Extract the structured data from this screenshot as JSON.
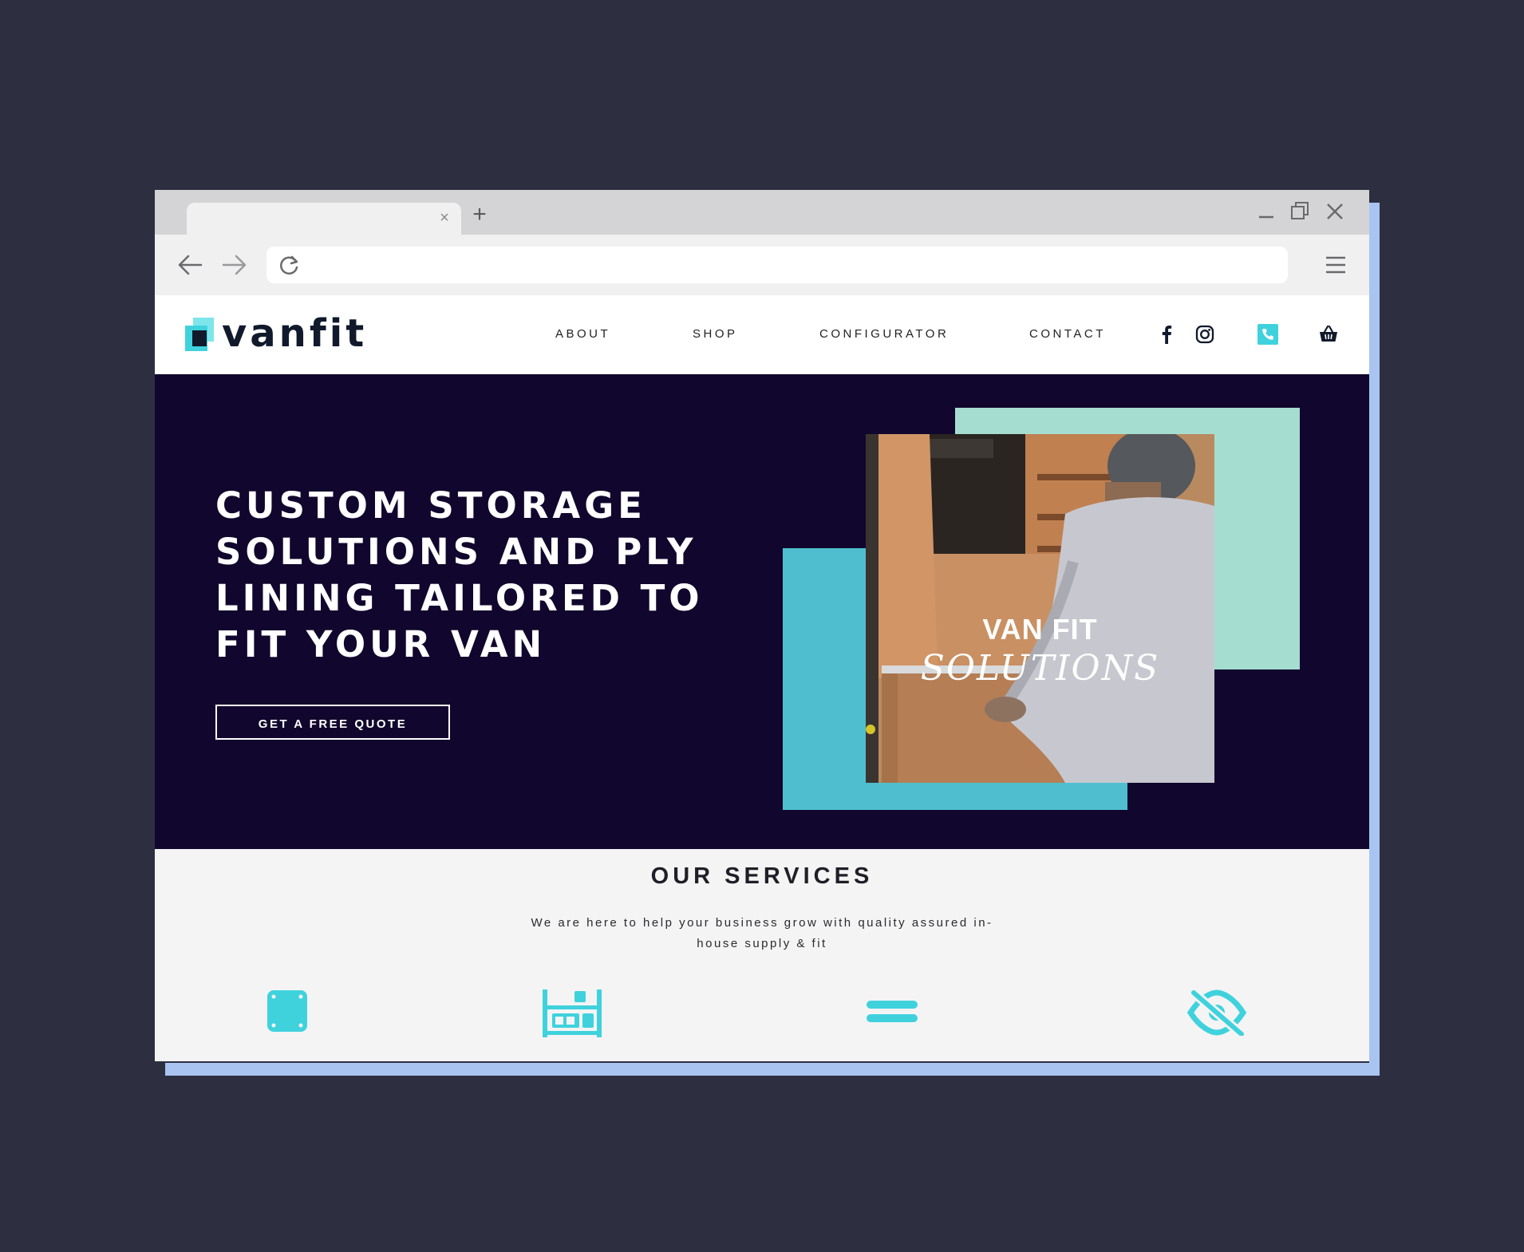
{
  "browser": {
    "tab_close": "×",
    "new_tab": "+",
    "url": ""
  },
  "header": {
    "logo_text": "vanfit",
    "nav": {
      "about": "ABOUT",
      "shop": "SHOP",
      "configurator": "CONFIGURATOR",
      "contact": "CONTACT"
    },
    "icons": [
      "facebook-icon",
      "instagram-icon",
      "phone-icon",
      "basket-icon"
    ]
  },
  "hero": {
    "title": "CUSTOM STORAGE SOLUTIONS AND PLY LINING TAILORED TO FIT YOUR VAN",
    "cta_label": "GET A FREE QUOTE",
    "photo_title": "VAN FIT",
    "photo_subtitle": "SOLUTIONS"
  },
  "services": {
    "title": "OUR SERVICES",
    "subtitle": "We are here to help your business grow with quality assured in-house supply & fit",
    "icons": [
      "panel-icon",
      "shelving-icon",
      "ply-lining-icon",
      "privacy-icon"
    ]
  },
  "colors": {
    "background": "#2d2f41",
    "hero_bg": "#11062d",
    "accent_cyan": "#3fd2dd",
    "mint": "#a6ddd1",
    "cyan_block": "#4fbfd0"
  }
}
